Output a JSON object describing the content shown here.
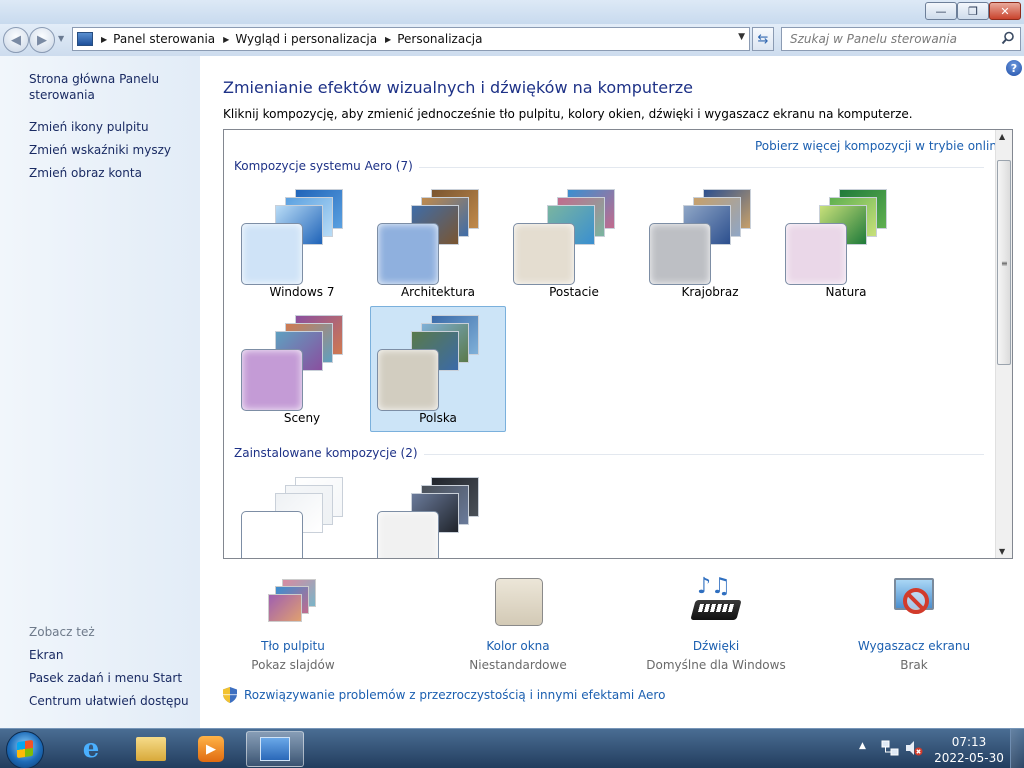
{
  "window": {
    "title_buttons": {
      "minimize": "—",
      "maximize": "❐",
      "close": "✕"
    }
  },
  "address": {
    "breadcrumbs": [
      "Panel sterowania",
      "Wygląd i personalizacja",
      "Personalizacja"
    ],
    "search_placeholder": "Szukaj w Panelu sterowania"
  },
  "sidebar": {
    "links": [
      "Strona główna Panelu sterowania",
      "Zmień ikony pulpitu",
      "Zmień wskaźniki myszy",
      "Zmień obraz konta"
    ],
    "see_also_title": "Zobacz też",
    "see_also": [
      "Ekran",
      "Pasek zadań i menu Start",
      "Centrum ułatwień dostępu"
    ]
  },
  "main": {
    "heading": "Zmienianie efektów wizualnych i dźwięków na komputerze",
    "subtext": "Kliknij kompozycję, aby zmienić jednocześnie tło pulpitu, kolory okien, dźwięki i wygaszacz ekranu na komputerze.",
    "online_link": "Pobierz więcej kompozycji w trybie online",
    "aero_group": "Kompozycje systemu Aero (7)",
    "installed_group": "Zainstalowane kompozycje (2)",
    "themes": [
      {
        "name": "Windows 7",
        "selected": false,
        "colors": [
          "#1f63b8",
          "#5aa0e0",
          "#b9dcf6"
        ],
        "swatch": "#cfe3f7"
      },
      {
        "name": "Architektura",
        "selected": false,
        "colors": [
          "#7a5530",
          "#c08a4c",
          "#3f6da8"
        ],
        "swatch": "#8fb0de"
      },
      {
        "name": "Postacie",
        "selected": false,
        "colors": [
          "#3a8fd0",
          "#c26b8d",
          "#7ab5a0"
        ],
        "swatch": "#e4ddd0"
      },
      {
        "name": "Krajobraz",
        "selected": false,
        "colors": [
          "#2c4f8e",
          "#c7a06a",
          "#8fa6c6"
        ],
        "swatch": "#bdbfc4"
      },
      {
        "name": "Natura",
        "selected": false,
        "colors": [
          "#1f7a3a",
          "#5fb050",
          "#c8e07a"
        ],
        "swatch": "#ead7e8"
      },
      {
        "name": "Sceny",
        "selected": false,
        "colors": [
          "#8a4f9f",
          "#d07a50",
          "#5fa0c0"
        ],
        "swatch": "#c49bd6"
      },
      {
        "name": "Polska",
        "selected": true,
        "colors": [
          "#3b6aa8",
          "#7fb0d8",
          "#5a7a4a"
        ],
        "swatch": "#d2cdc0"
      }
    ],
    "installed": [
      {
        "colors": [
          "#ffffff",
          "#f4f6f8",
          "#eef1f4"
        ],
        "swatch": "#ffffff"
      },
      {
        "colors": [
          "#20242b",
          "#4a5058",
          "#6a7a9a"
        ],
        "swatch": "#f1f1f1"
      }
    ]
  },
  "bottom": [
    {
      "label": "Tło pulpitu",
      "value": "Pokaz slajdów",
      "icon": "slideshow-icon"
    },
    {
      "label": "Kolor okna",
      "value": "Niestandardowe",
      "icon": "window-color-icon"
    },
    {
      "label": "Dźwięki",
      "value": "Domyślne dla Windows",
      "icon": "sounds-icon"
    },
    {
      "label": "Wygaszacz ekranu",
      "value": "Brak",
      "icon": "screensaver-icon"
    }
  ],
  "troubleshoot_link": "Rozwiązywanie problemów z przezroczystością i innymi efektami Aero",
  "taskbar": {
    "time": "07:13",
    "date": "2022-05-30"
  },
  "colors": {
    "link": "#1b5fb0",
    "heading": "#1e3287",
    "selection": "#cce4f7"
  }
}
